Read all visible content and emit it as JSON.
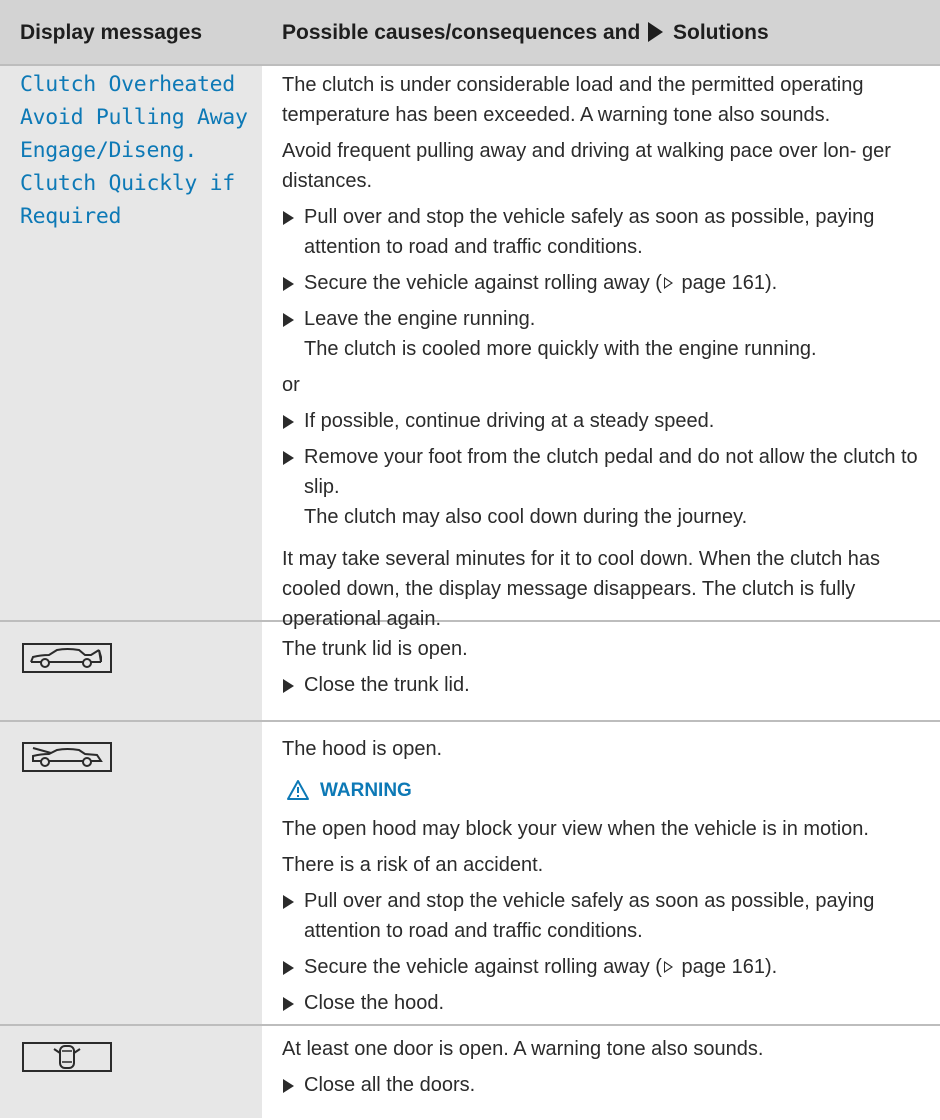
{
  "header": {
    "col1": "Display messages",
    "col2_prefix": "Possible causes/consequences and",
    "col2_suffix": "Solutions"
  },
  "rows": [
    {
      "message_lines": [
        "Clutch Overheated",
        "Avoid Pulling Away",
        "Engage/Diseng.",
        "Clutch Quickly if",
        "Required"
      ],
      "p1": "The clutch is under considerable load and the permitted operating temperature has been exceeded. A warning tone also sounds.",
      "p2": "Avoid frequent pulling away and driving at walking pace over lon- ger distances.",
      "s1": "Pull over and stop the vehicle safely as soon as possible, paying attention to road and traffic conditions.",
      "s2_a": "Secure the vehicle against rolling away (",
      "s2_b": "page 161).",
      "s3": "Leave the engine running.",
      "s3_sub": "The clutch is cooled more quickly with the engine running.",
      "or": "or",
      "s4": "If possible, continue driving at a steady speed.",
      "s5": "Remove your foot from the clutch pedal and do not allow the clutch to slip.",
      "s5_sub": "The clutch may also cool down during the journey.",
      "p3": "It may take several minutes for it to cool down. When the clutch has cooled down, the display message disappears. The clutch is fully operational again."
    },
    {
      "icon": "trunk-open-icon",
      "p1": "The trunk lid is open.",
      "s1": "Close the trunk lid."
    },
    {
      "icon": "hood-open-icon",
      "p1": "The hood is open.",
      "warning": "WARNING",
      "p2": "The open hood may block your view when the vehicle is in motion.",
      "p3": "There is a risk of an accident.",
      "s1": "Pull over and stop the vehicle safely as soon as possible, paying attention to road and traffic conditions.",
      "s2_a": "Secure the vehicle against rolling away (",
      "s2_b": "page 161).",
      "s3": "Close the hood."
    },
    {
      "icon": "door-open-icon",
      "p1": "At least one door is open. A warning tone also sounds.",
      "s1": "Close all the doors."
    }
  ],
  "colors": {
    "accent": "#0d79b6",
    "header_bg": "#d3d3d3",
    "left_bg": "#e7e7e7"
  }
}
